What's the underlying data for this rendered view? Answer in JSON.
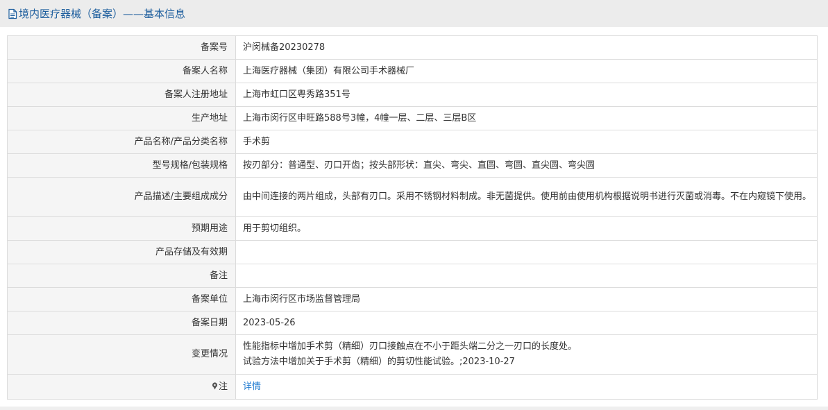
{
  "header": {
    "icon": "document-icon",
    "title": "境内医疗器械（备案）——基本信息"
  },
  "record": {
    "filing_no": {
      "label": "备案号",
      "value": "沪闵械备20230278"
    },
    "filer_name": {
      "label": "备案人名称",
      "value": "上海医疗器械（集团）有限公司手术器械厂"
    },
    "filer_address": {
      "label": "备案人注册地址",
      "value": "上海市虹口区粤秀路351号"
    },
    "production_address": {
      "label": "生产地址",
      "value": "上海市闵行区申旺路588号3幢，4幢一层、二层、三层B区"
    },
    "product_name": {
      "label": "产品名称/产品分类名称",
      "value": "手术剪"
    },
    "model_spec": {
      "label": "型号规格/包装规格",
      "value": "按刃部分：普通型、刃口开齿；按头部形状：直尖、弯尖、直圆、弯圆、直尖圆、弯尖圆"
    },
    "description": {
      "label": "产品描述/主要组成成分",
      "value": "由中间连接的两片组成，头部有刃口。采用不锈钢材料制成。非无菌提供。使用前由使用机构根据说明书进行灭菌或消毒。不在内窥镜下使用。"
    },
    "intended_use": {
      "label": "预期用途",
      "value": "用于剪切组织。"
    },
    "storage": {
      "label": "产品存储及有效期",
      "value": ""
    },
    "remarks": {
      "label": "备注",
      "value": ""
    },
    "filing_unit": {
      "label": "备案单位",
      "value": "上海市闵行区市场监督管理局"
    },
    "filing_date": {
      "label": "备案日期",
      "value": "2023-05-26"
    },
    "changes": {
      "label": "变更情况",
      "line1": "性能指标中增加手术剪（精细）刃口接触点在不小于距头端二分之一刃口的长度处。",
      "line2": "试验方法中增加关于手术剪（精细）的剪切性能试验。;2023-10-27"
    },
    "note": {
      "icon": "pin-icon",
      "label": "注",
      "link": "详情"
    }
  },
  "colors": {
    "header_bg": "#ececec",
    "title_blue": "#1f5f9e",
    "label_bg": "#f5f5f5",
    "border": "#dcdcdc",
    "link_blue": "#1f7bd0"
  }
}
